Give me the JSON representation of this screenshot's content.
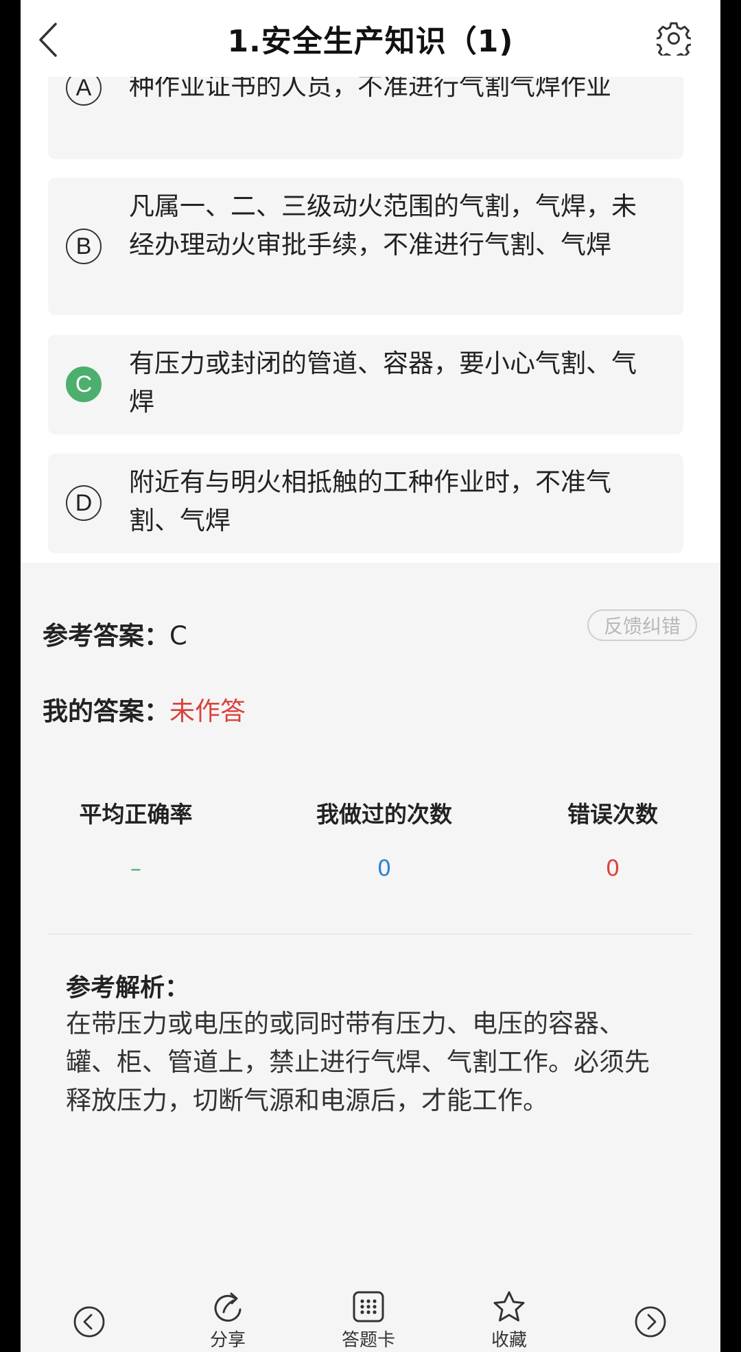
{
  "header": {
    "title": "1.安全生产知识（1)"
  },
  "options": [
    {
      "letter": "A",
      "text": "种作业证书的人员，不准进行气割气焊作业",
      "correct": false
    },
    {
      "letter": "B",
      "text": "凡属一、二、三级动火范围的气割，气焊，未经办理动火审批手续，不准进行气割、气焊",
      "correct": false
    },
    {
      "letter": "C",
      "text": "有压力或封闭的管道、容器，要小心气割、气焊",
      "correct": true
    },
    {
      "letter": "D",
      "text": "附近有与明火相抵触的工种作业时，不准气割、气焊",
      "correct": false
    }
  ],
  "answer": {
    "ref_label": "参考答案：",
    "ref_value": "C",
    "my_label": "我的答案：",
    "my_value": "未作答",
    "feedback_label": "反馈纠错"
  },
  "stats": {
    "accuracy_label": "平均正确率",
    "accuracy_value": "–",
    "done_label": "我做过的次数",
    "done_value": "0",
    "wrong_label": "错误次数",
    "wrong_value": "0"
  },
  "explanation": {
    "title": "参考解析：",
    "text": "在带压力或电压的或同时带有压力、电压的容器、罐、柜、管道上，禁止进行气焊、气割工作。必须先释放压力，切断气源和电源后，才能工作。"
  },
  "toolbar": {
    "share_label": "分享",
    "card_label": "答题卡",
    "favorite_label": "收藏"
  },
  "colors": {
    "correct": "#4caf6e",
    "red": "#d9433b",
    "blue": "#2f7fd4",
    "green": "#4caf6e"
  }
}
